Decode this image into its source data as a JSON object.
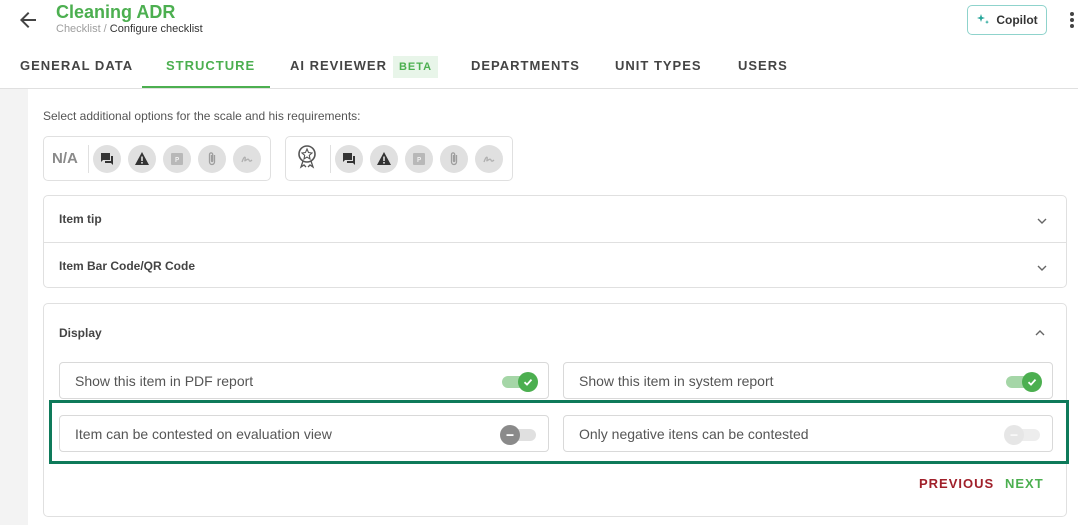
{
  "header": {
    "title": "Cleaning ADR",
    "breadcrumb_parent": "Checklist",
    "breadcrumb_separator": " / ",
    "breadcrumb_current": "Configure checklist",
    "copilot_label": "Copilot"
  },
  "tabs": [
    {
      "label": "GENERAL DATA"
    },
    {
      "label": "STRUCTURE",
      "active": true
    },
    {
      "label": "AI REVIEWER",
      "badge": "BETA"
    },
    {
      "label": "DEPARTMENTS"
    },
    {
      "label": "UNIT TYPES"
    },
    {
      "label": "USERS"
    }
  ],
  "options": {
    "label": "Select additional options for the scale and his requirements:",
    "na_label": "N/A",
    "group1_icons": [
      "comment-icon",
      "warning-icon",
      "action-plan-icon",
      "attachment-icon",
      "signature-icon"
    ],
    "group2_icons": [
      "badge-icon",
      "comment-icon",
      "warning-icon",
      "action-plan-icon",
      "attachment-icon",
      "signature-icon"
    ]
  },
  "accordions": [
    {
      "label": "Item tip"
    },
    {
      "label": "Item Bar Code/QR Code"
    }
  ],
  "display": {
    "title": "Display",
    "toggles": [
      {
        "label": "Show this item in PDF report",
        "state": "on"
      },
      {
        "label": "Show this item in system report",
        "state": "on"
      },
      {
        "label": "Item can be contested on evaluation view",
        "state": "off"
      },
      {
        "label": "Only negative itens can be contested",
        "state": "disabled"
      }
    ]
  },
  "footer": {
    "previous_label": "PREVIOUS",
    "next_label": "NEXT"
  },
  "colors": {
    "brand_green": "#4caf50",
    "previous_red": "#a0202a",
    "highlight": "#0e7a5a"
  }
}
